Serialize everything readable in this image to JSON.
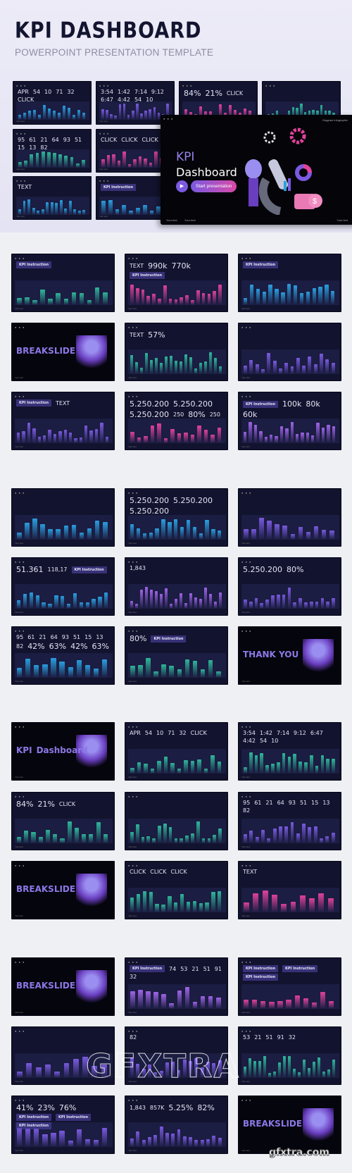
{
  "header": {
    "title": "KPI DASHBOARD",
    "subtitle": "POWERPOINT PRESENTATION TEMPLATE"
  },
  "colors": {
    "slide_bg": "#12132e",
    "accent_purple": "#7a5ae0",
    "accent_pink": "#e0429a",
    "accent_blue": "#2a9fe0",
    "accent_green": "#2fb79a"
  },
  "featured_slide": {
    "corner_label": "Diagram infographic",
    "kpi": "KPI",
    "dashboard": "Dashboard",
    "play_icon": "play-icon",
    "start_button": "Start presentation",
    "footer": [
      "Your text",
      "Your text",
      "Your text"
    ]
  },
  "hero_slides": [
    {
      "texts": [
        "APR",
        "54",
        "10",
        "71",
        "32",
        "CLICK"
      ]
    },
    {
      "texts": [
        "3:54",
        "1:42",
        "7:14",
        "9:12",
        "6:47",
        "4:42",
        "54",
        "10"
      ]
    },
    {
      "texts": [
        "84%",
        "21%",
        "CLICK"
      ]
    },
    {
      "texts": []
    },
    {
      "texts": [
        "95",
        "61",
        "21",
        "64",
        "93",
        "51",
        "15",
        "13",
        "82"
      ]
    },
    {
      "texts": [
        "CLICK",
        "CLICK",
        "CLICK"
      ]
    },
    {
      "texts": [
        "TEXT"
      ]
    },
    {
      "texts": [
        "KPI Instruction"
      ]
    }
  ],
  "sections": [
    [
      {
        "texts": [
          "KPI Instruction"
        ]
      },
      {
        "texts": [
          "TEXT",
          "990k",
          "770k",
          "KPI Instruction"
        ]
      },
      {
        "texts": [
          "KPI Instruction"
        ]
      },
      {
        "break": true,
        "texts": [
          "BREAKSLIDE"
        ]
      },
      {
        "texts": [
          "TEXT",
          "57%"
        ]
      },
      {
        "texts": []
      },
      {
        "texts": [
          "KPI Instruction",
          "TEXT"
        ]
      },
      {
        "texts": [
          "5.250.200",
          "5.250.200",
          "5.250.200",
          "250",
          "80%",
          "250"
        ]
      },
      {
        "texts": [
          "KPI Instruction",
          "100k",
          "80k",
          "60k"
        ]
      }
    ],
    [
      {
        "texts": []
      },
      {
        "texts": [
          "5.250.200",
          "5.250.200",
          "5.250.200"
        ]
      },
      {
        "texts": []
      },
      {
        "texts": [
          "51.361",
          "118,17",
          "KPI Instruction"
        ]
      },
      {
        "texts": [
          "1,843"
        ]
      },
      {
        "texts": [
          "5.250.200",
          "80%"
        ]
      },
      {
        "texts": [
          "95",
          "61",
          "21",
          "64",
          "93",
          "51",
          "15",
          "13",
          "82",
          "42%",
          "63%",
          "42%",
          "63%"
        ]
      },
      {
        "texts": [
          "80%",
          "KPI Instruction"
        ]
      },
      {
        "break": true,
        "texts": [
          "THANK YOU"
        ]
      }
    ],
    [
      {
        "break": true,
        "texts": [
          "KPI",
          "Dashboard"
        ]
      },
      {
        "texts": [
          "APR",
          "54",
          "10",
          "71",
          "32",
          "CLICK"
        ]
      },
      {
        "texts": [
          "3:54",
          "1:42",
          "7:14",
          "9:12",
          "6:47",
          "4:42",
          "54",
          "10"
        ]
      },
      {
        "texts": [
          "84%",
          "21%",
          "CLICK"
        ]
      },
      {
        "texts": []
      },
      {
        "texts": [
          "95",
          "61",
          "21",
          "64",
          "93",
          "51",
          "15",
          "13",
          "82"
        ]
      },
      {
        "break": true,
        "texts": [
          "BREAKSLIDE"
        ]
      },
      {
        "texts": [
          "CLICK",
          "CLICK",
          "CLICK"
        ]
      },
      {
        "texts": [
          "TEXT"
        ]
      }
    ],
    [
      {
        "break": true,
        "texts": [
          "BREAKSLIDE"
        ]
      },
      {
        "texts": [
          "KPI Instruction",
          "74",
          "53",
          "21",
          "51",
          "91",
          "32"
        ]
      },
      {
        "texts": [
          "KPI Instruction",
          "KPI Instruction",
          "KPI Instruction"
        ]
      },
      {
        "texts": []
      },
      {
        "texts": [
          "82"
        ]
      },
      {
        "texts": [
          "53",
          "21",
          "51",
          "91",
          "32"
        ]
      },
      {
        "texts": [
          "41%",
          "23%",
          "76%",
          "KPI Instruction",
          "KPI Instruction",
          "KPI Instruction"
        ]
      },
      {
        "texts": [
          "1,843",
          "857K",
          "5.25%",
          "82%"
        ]
      },
      {
        "break": true,
        "texts": [
          "BREAKSLIDE"
        ]
      }
    ]
  ],
  "slide_footer": "Your text",
  "watermarks": [
    "GFXTRA",
    "gfxtra.com"
  ]
}
